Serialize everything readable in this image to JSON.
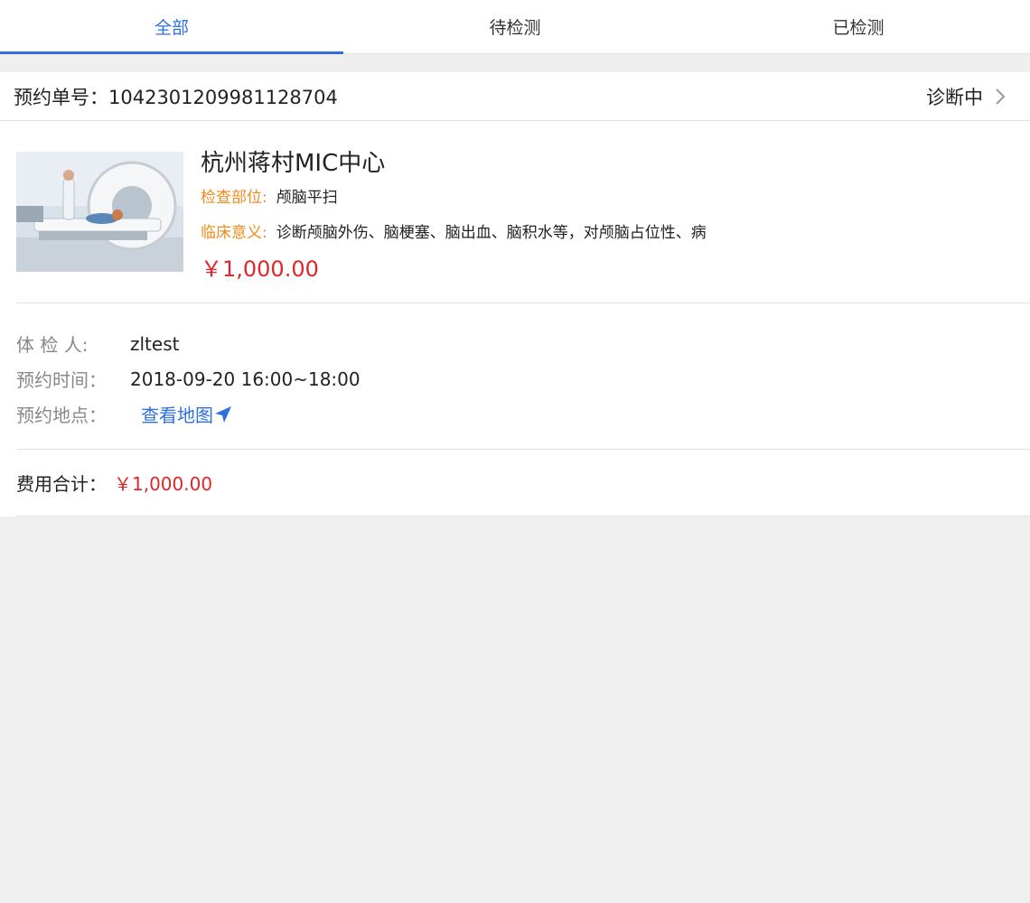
{
  "tabs": [
    {
      "label": "全部",
      "active": true
    },
    {
      "label": "待检测",
      "active": false
    },
    {
      "label": "已检测",
      "active": false
    }
  ],
  "order": {
    "number_label": "预约单号：",
    "number": "104230120998112870 4",
    "status": "诊断中"
  },
  "item": {
    "center_name": "杭州蒋村MIC中心",
    "part_label": "检查部位:",
    "part_value": "颅脑平扫",
    "significance_label": "临床意义:",
    "significance_value": "诊断颅脑外伤、脑梗塞、脑出血、脑积水等，对颅脑占位性、病",
    "price": "￥1,000.00"
  },
  "details": {
    "person_label": "体 检 人:",
    "person_value": "zltest",
    "time_label": "预约时间：",
    "time_value": "2018-09-20 16:00~18:00",
    "place_label": "预约地点：",
    "map_link": "查看地图"
  },
  "total": {
    "label": "费用合计：",
    "value": "￥1,000.00"
  },
  "colors": {
    "accent": "#2f6fe0",
    "price": "#e0262a",
    "label_orange": "#f08a1c"
  }
}
